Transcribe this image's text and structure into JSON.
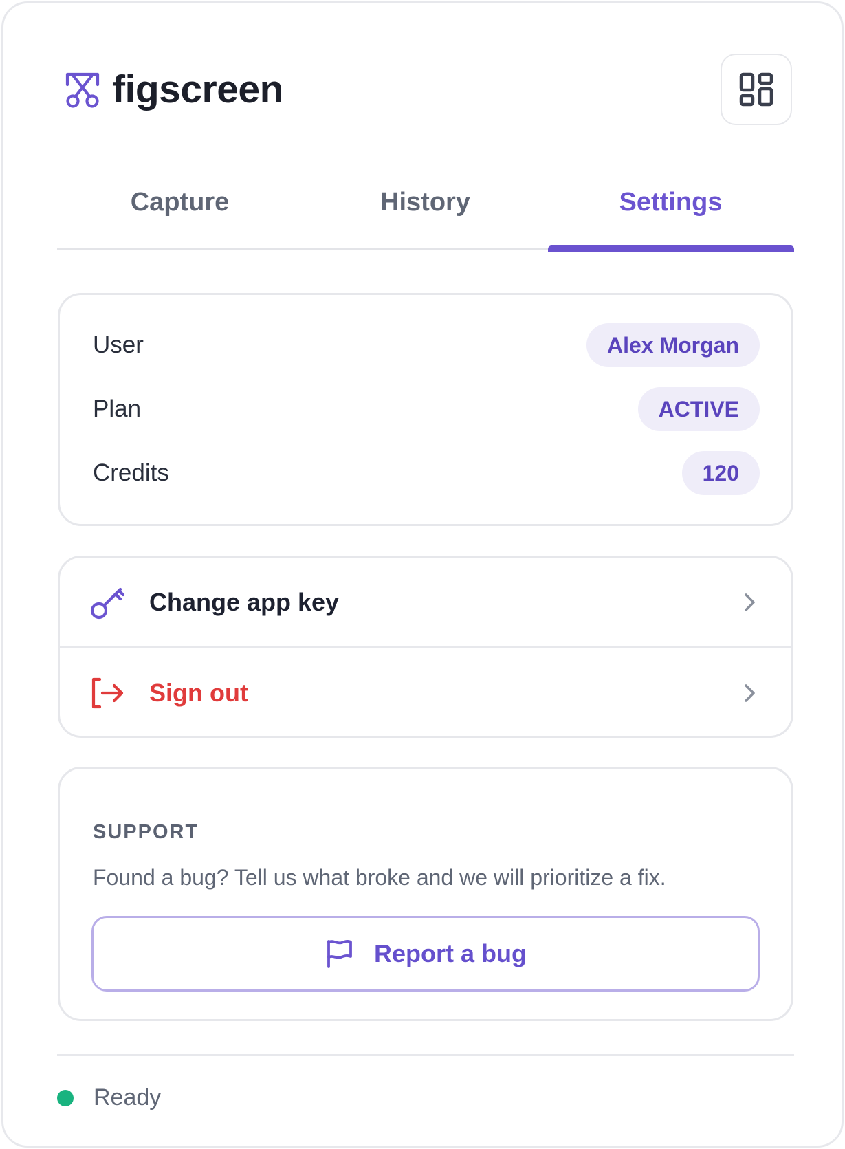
{
  "app": {
    "name": "figscreen"
  },
  "header": {
    "logo_icon": "scissors-frame-icon",
    "layout_icon": "layout-grid-icon"
  },
  "tabs": [
    {
      "label": "Capture",
      "active": false
    },
    {
      "label": "History",
      "active": false
    },
    {
      "label": "Settings",
      "active": true
    }
  ],
  "account": {
    "user_label": "User",
    "user_value": "Alex Morgan",
    "plan_label": "Plan",
    "plan_value": "ACTIVE",
    "credits_label": "Credits",
    "credits_value": "120"
  },
  "actions": [
    {
      "label": "Change app key",
      "icon": "key-icon"
    },
    {
      "label": "Sign out",
      "icon": "sign-out-icon"
    }
  ],
  "support": {
    "title": "SUPPORT",
    "text": "Found a bug? Tell us what broke and we will prioritize a fix.",
    "button_label": "Report a bug",
    "button_icon": "flag-icon"
  },
  "status": {
    "text": "Ready",
    "color": "#19b37f"
  },
  "colors": {
    "accent": "#6a52cf",
    "danger": "#e03b3b",
    "pill_bg": "#efedf9"
  }
}
